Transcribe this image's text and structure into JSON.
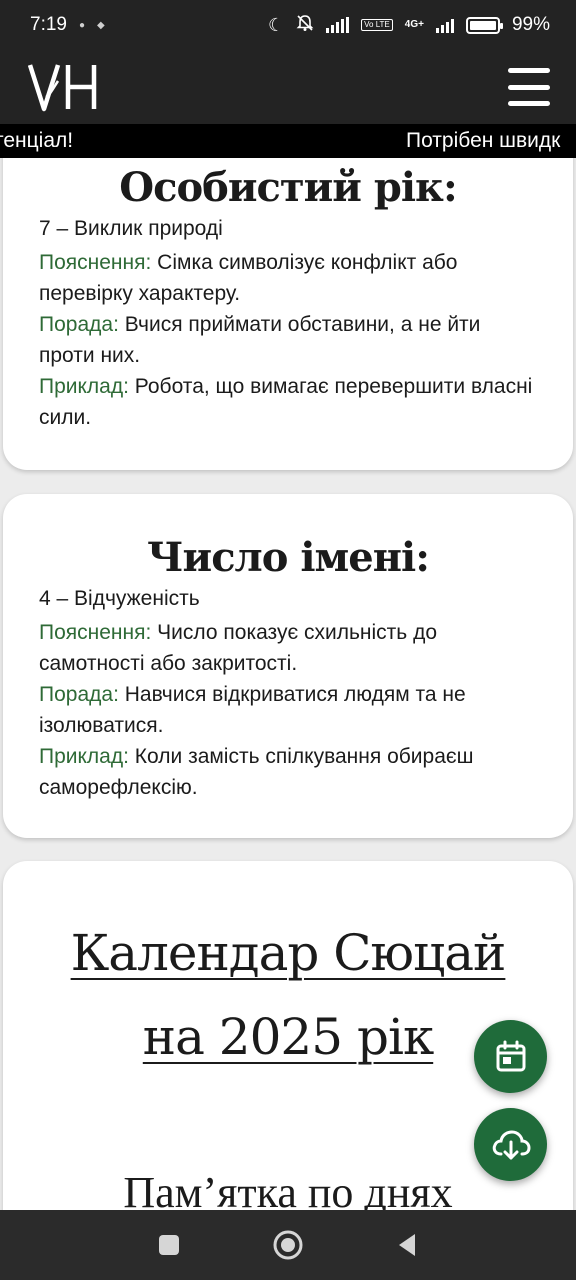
{
  "status_bar": {
    "time": "7:19",
    "lte_tag": "Vo LTE",
    "network": "4G+",
    "battery_percent": "99%",
    "battery_level": 0.99
  },
  "header": {
    "logo_text": "VH"
  },
  "ticker": {
    "left_text": "тенціал!",
    "right_text": "Потрібен швидк"
  },
  "cards": [
    {
      "title": "Особистий рік:",
      "value": "7 – Виклик природі",
      "explanation_label": "Пояснення:",
      "explanation": "Сімка символізує конфлікт або перевірку характеру.",
      "advice_label": "Порада:",
      "advice": "Вчися приймати обставини, а не йти проти них.",
      "example_label": "Приклад:",
      "example": "Робота, що вимагає перевершити власні сили."
    },
    {
      "title": "Число імені:",
      "value": "4 – Відчуженість",
      "explanation_label": "Пояснення:",
      "explanation": "Число показує схильність до самотності або закритості.",
      "advice_label": "Порада:",
      "advice": "Навчися відкриватися людям та не ізолюватися.",
      "example_label": "Приклад:",
      "example": "Коли замість спілкування обираєш саморефлексію."
    }
  ],
  "calendar": {
    "title_line1": "Календар Сюцай",
    "title_line2": "на 2025 рік",
    "subtitle": "Пам’ятка по днях"
  },
  "colors": {
    "accent_green": "#2e6a36",
    "fab_green": "#1f6b3a",
    "header_bg": "#232323"
  },
  "icons": {
    "fab_calendar": "calendar-icon",
    "fab_download": "cloud-download-icon"
  }
}
